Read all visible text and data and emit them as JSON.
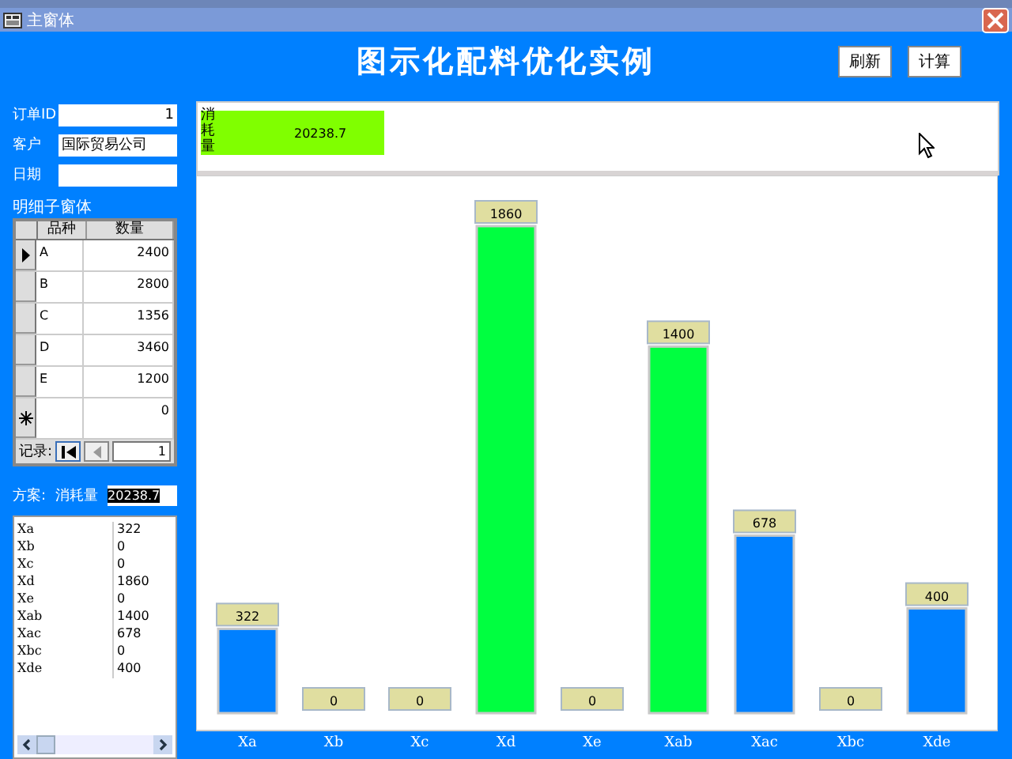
{
  "window": {
    "title": "主窗体"
  },
  "header": {
    "title": "图示化配料优化实例",
    "buttons": [
      "刷新",
      "计算"
    ]
  },
  "fields": [
    {
      "label": "订单ID",
      "value": "1"
    },
    {
      "label": "客户",
      "value": "国际贸易公司"
    },
    {
      "label": "日期"
    }
  ],
  "subform": {
    "label": "明细子窗体",
    "columns": [
      "品种",
      "数量"
    ],
    "rows": [
      {
        "item": "A",
        "qty": "2400",
        "selected": true
      },
      {
        "item": "B",
        "qty": "2800",
        "selected": false
      },
      {
        "item": "C",
        "qty": "1356",
        "selected": false
      },
      {
        "item": "D",
        "qty": "3460",
        "selected": false
      },
      {
        "item": "E",
        "qty": "1200",
        "selected": false
      }
    ],
    "new_row": {
      "qty": "0"
    },
    "navigator": {
      "label": "记录:",
      "value": "1"
    }
  },
  "plan": {
    "label": "方案:",
    "consumption_label": "消耗量",
    "consumption_value": "20238.7",
    "highlighted": true,
    "rows": [
      {
        "name": "Xa",
        "value": "322"
      },
      {
        "name": "Xb",
        "value": "0"
      },
      {
        "name": "Xc",
        "value": "0"
      },
      {
        "name": "Xd",
        "value": "1860"
      },
      {
        "name": "Xe",
        "value": "0"
      },
      {
        "name": "Xab",
        "value": "1400"
      },
      {
        "name": "Xac",
        "value": "678"
      },
      {
        "name": "Xbc",
        "value": "0"
      },
      {
        "name": "Xde",
        "value": "400"
      }
    ]
  },
  "chart": {
    "summary": {
      "label": "消耗量",
      "value": "20238.7"
    },
    "chart_data": {
      "type": "bar",
      "categories": [
        "Xa",
        "Xb",
        "Xc",
        "Xd",
        "Xe",
        "Xab",
        "Xac",
        "Xbc",
        "Xde"
      ],
      "stacked": true,
      "data_labels": true,
      "ylim": [
        0,
        1860
      ],
      "series": [
        {
          "color": "#0080ff",
          "values": [
            322,
            0,
            0,
            null,
            0,
            null,
            678,
            0,
            400
          ]
        },
        {
          "color": "#00ff40",
          "values": [
            null,
            null,
            null,
            1860,
            null,
            1400,
            null,
            null,
            null
          ]
        }
      ]
    }
  }
}
